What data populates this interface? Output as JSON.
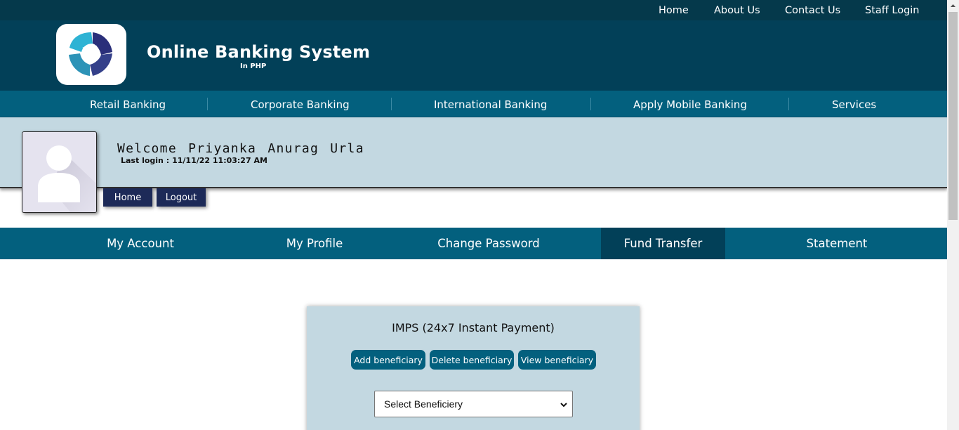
{
  "topnav": {
    "items": [
      "Home",
      "About Us",
      "Contact Us",
      "Staff Login"
    ]
  },
  "brand": {
    "title": "Online Banking System",
    "subtitle": "In PHP",
    "logo_icon": "bank-logo-icon"
  },
  "mainnav": {
    "items": [
      "Retail Banking",
      "Corporate Banking",
      "International Banking",
      "Apply Mobile Banking",
      "Services"
    ]
  },
  "user": {
    "welcome": "Welcome Priyanka Anurag Urla",
    "last_login_label": "Last login :",
    "last_login_value": "11/11/22 11:03:27 AM",
    "avatar_icon": "user-avatar-icon",
    "home_button": "Home",
    "logout_button": "Logout"
  },
  "account_nav": {
    "tabs": [
      "My Account",
      "My Profile",
      "Change Password",
      "Fund Transfer",
      "Statement"
    ],
    "active": "Fund Transfer"
  },
  "imps": {
    "title": "IMPS (24x7 Instant Payment)",
    "buttons": [
      "Add beneficiary",
      "Delete beneficiary",
      "View beneficiary"
    ],
    "select_placeholder": "Select Beneficiery"
  },
  "colors": {
    "topbar": "#05394b",
    "header": "#024058",
    "nav": "#03607e",
    "panel": "#c3d8e1",
    "dark_button": "#1d2a58"
  }
}
